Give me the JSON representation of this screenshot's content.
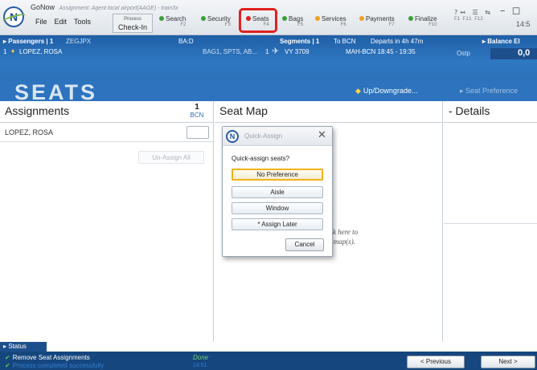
{
  "app": {
    "name": "GoNow",
    "subtitle": "Assignment: Agent local airport(AAGE) - train3x"
  },
  "menu": [
    "File",
    "Edit",
    "Tools"
  ],
  "process_button": {
    "small": "Process",
    "label": "Check-In"
  },
  "toolbar": [
    {
      "label": "Search",
      "key": "F2",
      "status": "green"
    },
    {
      "label": "Security",
      "key": "F3",
      "status": "green"
    },
    {
      "label": "Seats",
      "key": "F4",
      "status": "red"
    },
    {
      "label": "Bags",
      "key": "F5",
      "status": "green"
    },
    {
      "label": "Services",
      "key": "F6",
      "status": "orange"
    },
    {
      "label": "Payments",
      "key": "F7",
      "status": "orange"
    },
    {
      "label": "Finalize",
      "key": "F10",
      "status": "green"
    }
  ],
  "fn_keys": "F1 F11 F12",
  "clock": "14:5",
  "passengers_bar": {
    "label": "Passengers | 1",
    "pnr": "ZEGJPX",
    "ba": "BA:D",
    "pax_row": "1",
    "pax_name": "LOPEZ, ROSA",
    "services": "BAG1, SPTS, AB...",
    "segments_label": "Segments | 1",
    "destination": "To BCN",
    "departs": "Departs in 4h 47m",
    "flight_num": "1",
    "flight": "VY 3709",
    "route": "MAH-BCN 18:45 - 19:35",
    "balance_label": "Balance",
    "balance_extra": "El",
    "balance_sub": "Ostp",
    "balance_value": "0,0"
  },
  "page_title": "SEATS",
  "actions": {
    "updown": "Up/Downgrade...",
    "seat_pref": "Seat Preference"
  },
  "assignments": {
    "heading": "Assignments",
    "count": "1",
    "city": "BCN",
    "passenger": "LOPEZ, ROSA",
    "unassign_label": "Un-Assign All"
  },
  "seat_map": {
    "heading": "Seat Map",
    "hint_line1": "ck here to",
    "hint_line2": "t map(s)."
  },
  "details": {
    "heading": "- Details"
  },
  "dialog": {
    "title": "Quick-Assign",
    "question": "Quick-assign seats?",
    "options": [
      "No Preference",
      "Aisle",
      "Window",
      "* Assign Later"
    ],
    "cancel": "Cancel"
  },
  "status": {
    "tab": "Status",
    "row1": "Remove Seat Assignments",
    "row1_state": "Done",
    "row2": "Process completed successfully",
    "row2_time": "14:51"
  },
  "nav": {
    "previous": "< Previous",
    "next": "Next >"
  },
  "colors": {
    "blue_bar": "#2a6cb5",
    "highlight": "#e0211f",
    "selected_option": "#f2b21a",
    "footer": "#16467e"
  }
}
